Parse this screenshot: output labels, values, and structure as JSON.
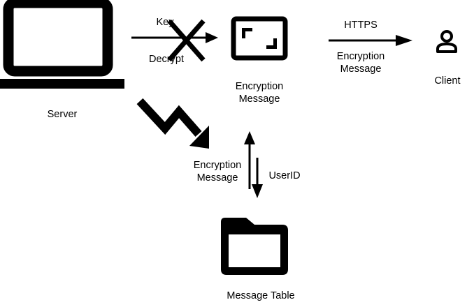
{
  "nodes": {
    "server": {
      "label": "Server"
    },
    "encryption_message": {
      "label_line1": "Encryption",
      "label_line2": "Message"
    },
    "client": {
      "label": "Client"
    },
    "message_table": {
      "label": "Message Table"
    }
  },
  "edges": {
    "server_to_message": {
      "label_top": "Key",
      "label_bottom": "Decrypt",
      "blocked": true
    },
    "message_to_client": {
      "label_top": "HTTPS",
      "label_bottom_line1": "Encryption",
      "label_bottom_line2": "Message"
    },
    "server_to_table": {
      "style": "zigzag"
    },
    "table_to_message": {
      "label_line1": "Encryption",
      "label_line2": "Message"
    },
    "message_to_table": {
      "label": "UserID"
    }
  },
  "colors": {
    "stroke": "#000000",
    "background": "#ffffff"
  },
  "icons": {
    "server": "laptop-icon",
    "encryption_message": "framed-corners-icon",
    "client": "person-icon",
    "message_table": "folder-icon"
  }
}
